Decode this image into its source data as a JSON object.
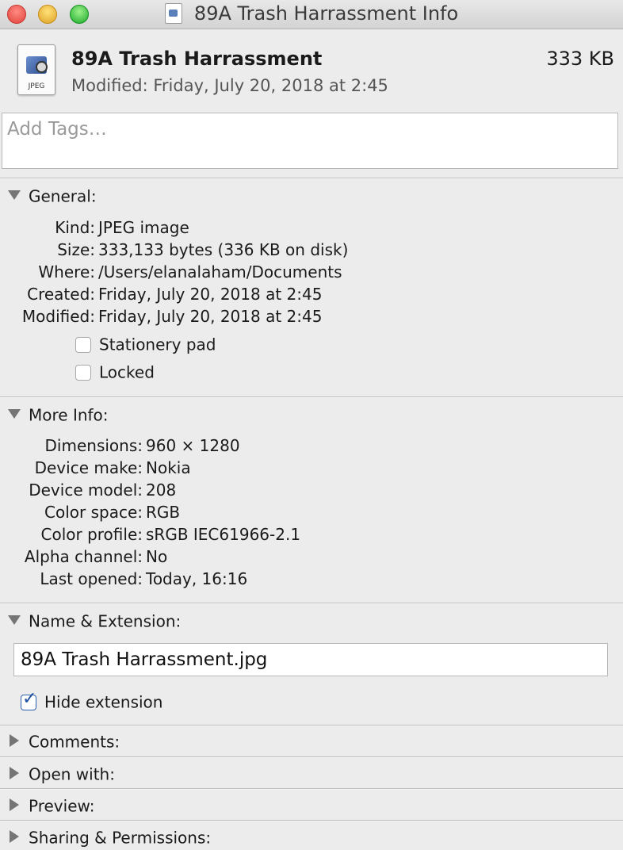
{
  "window": {
    "title": "89A Trash Harrassment Info"
  },
  "header": {
    "file_name": "89A Trash Harrassment",
    "file_size": "333 KB",
    "modified": "Modified: Friday, July 20, 2018 at 2:45",
    "icon_type_label": "JPEG"
  },
  "tags": {
    "placeholder": "Add Tags…"
  },
  "general": {
    "heading": "General:",
    "fields": [
      {
        "label": "Kind:",
        "value": "JPEG image"
      },
      {
        "label": "Size:",
        "value": "333,133 bytes (336 KB on disk)"
      },
      {
        "label": "Where:",
        "value": "/Users/elanalaham/Documents"
      },
      {
        "label": "Created:",
        "value": "Friday, July 20, 2018 at 2:45"
      },
      {
        "label": "Modified:",
        "value": "Friday, July 20, 2018 at 2:45"
      }
    ],
    "stationery_label": "Stationery pad",
    "stationery_checked": false,
    "locked_label": "Locked",
    "locked_checked": false
  },
  "more_info": {
    "heading": "More Info:",
    "fields": [
      {
        "label": "Dimensions:",
        "value": "960 × 1280"
      },
      {
        "label": "Device make:",
        "value": "Nokia"
      },
      {
        "label": "Device model:",
        "value": "208"
      },
      {
        "label": "Color space:",
        "value": "RGB"
      },
      {
        "label": "Color profile:",
        "value": "sRGB IEC61966-2.1"
      },
      {
        "label": "Alpha channel:",
        "value": "No"
      },
      {
        "label": "Last opened:",
        "value": "Today, 16:16"
      }
    ]
  },
  "name_extension": {
    "heading": "Name & Extension:",
    "value": "89A Trash Harrassment.jpg",
    "hide_extension_label": "Hide extension",
    "hide_extension_checked": true
  },
  "collapsed_sections": {
    "comments": "Comments:",
    "open_with": "Open with:",
    "preview": "Preview:",
    "sharing": "Sharing & Permissions:"
  }
}
